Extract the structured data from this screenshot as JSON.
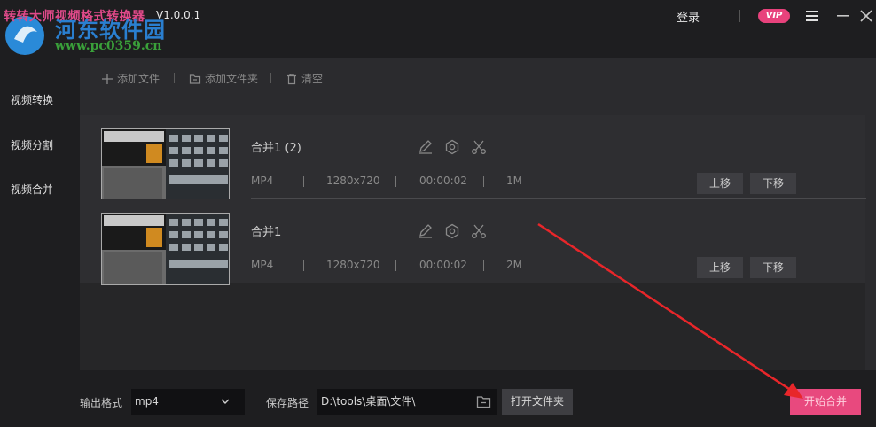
{
  "app": {
    "title": "转转大师视频格式转换器",
    "version": "V1.0.0.1",
    "watermark": "河东软件园",
    "watermark_url": "www.pc0359.cn"
  },
  "header": {
    "login_label": "登录",
    "vip_label": "VIP"
  },
  "sidebar": {
    "items": [
      {
        "label": "视频转换"
      },
      {
        "label": "视频分割"
      },
      {
        "label": "视频合并"
      }
    ]
  },
  "toolbar": {
    "add_file": "添加文件",
    "add_folder": "添加文件夹",
    "clear": "清空"
  },
  "files": [
    {
      "name": "合并1 (2)",
      "format": "MP4",
      "resolution": "1280x720",
      "duration": "00:00:02",
      "size": "1M",
      "move_up": "上移",
      "move_down": "下移"
    },
    {
      "name": "合并1",
      "format": "MP4",
      "resolution": "1280x720",
      "duration": "00:00:02",
      "size": "2M",
      "move_up": "上移",
      "move_down": "下移"
    }
  ],
  "bottom": {
    "format_label": "输出格式",
    "format_value": "mp4",
    "path_label": "保存路径",
    "path_value": "D:\\tools\\桌面\\文件\\",
    "open_folder": "打开文件夹",
    "start": "开始合并"
  },
  "colors": {
    "accent": "#e8497e",
    "background": "#1e1e20",
    "panel": "#2b2b2e",
    "annotation_arrow": "#e8262a"
  }
}
